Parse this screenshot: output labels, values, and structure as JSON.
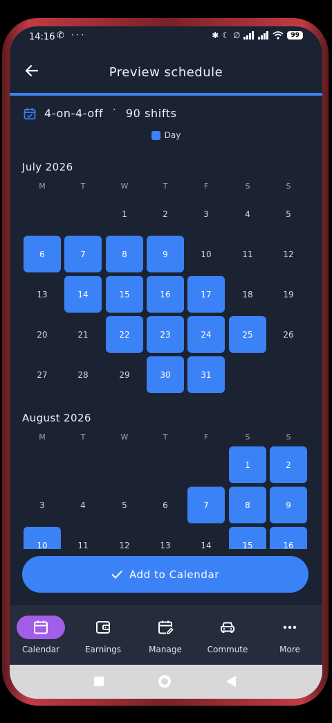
{
  "status": {
    "time": "14:16",
    "left_icons": "✆ ···",
    "battery": "99"
  },
  "header": {
    "title": "Preview schedule"
  },
  "summary": {
    "pattern": "4-on-4-off",
    "separator": "˙",
    "shifts": "90 shifts"
  },
  "legend": {
    "day_label": "Day",
    "day_color": "#3b82f6"
  },
  "weekdays": [
    "M",
    "T",
    "W",
    "T",
    "F",
    "S",
    "S"
  ],
  "months": [
    {
      "title": "July 2026",
      "rows": [
        [
          {
            "d": ""
          },
          {
            "d": ""
          },
          {
            "d": "1"
          },
          {
            "d": "2"
          },
          {
            "d": "3"
          },
          {
            "d": "4"
          },
          {
            "d": "5"
          }
        ],
        [
          {
            "d": "6",
            "s": 1
          },
          {
            "d": "7",
            "s": 1
          },
          {
            "d": "8",
            "s": 1
          },
          {
            "d": "9",
            "s": 1
          },
          {
            "d": "10"
          },
          {
            "d": "11"
          },
          {
            "d": "12"
          }
        ],
        [
          {
            "d": "13"
          },
          {
            "d": "14",
            "s": 1
          },
          {
            "d": "15",
            "s": 1
          },
          {
            "d": "16",
            "s": 1
          },
          {
            "d": "17",
            "s": 1
          },
          {
            "d": "18"
          },
          {
            "d": "19"
          }
        ],
        [
          {
            "d": "20"
          },
          {
            "d": "21"
          },
          {
            "d": "22",
            "s": 1
          },
          {
            "d": "23",
            "s": 1
          },
          {
            "d": "24",
            "s": 1
          },
          {
            "d": "25",
            "s": 1
          },
          {
            "d": "26"
          }
        ],
        [
          {
            "d": "27"
          },
          {
            "d": "28"
          },
          {
            "d": "29"
          },
          {
            "d": "30",
            "s": 1
          },
          {
            "d": "31",
            "s": 1
          },
          {
            "d": ""
          },
          {
            "d": ""
          }
        ]
      ]
    },
    {
      "title": "August 2026",
      "rows": [
        [
          {
            "d": ""
          },
          {
            "d": ""
          },
          {
            "d": ""
          },
          {
            "d": ""
          },
          {
            "d": ""
          },
          {
            "d": "1",
            "s": 1
          },
          {
            "d": "2",
            "s": 1
          }
        ],
        [
          {
            "d": "3"
          },
          {
            "d": "4"
          },
          {
            "d": "5"
          },
          {
            "d": "6"
          },
          {
            "d": "7",
            "s": 1
          },
          {
            "d": "8",
            "s": 1
          },
          {
            "d": "9",
            "s": 1
          }
        ],
        [
          {
            "d": "10",
            "s": 1
          },
          {
            "d": "11"
          },
          {
            "d": "12"
          },
          {
            "d": "13"
          },
          {
            "d": "14"
          },
          {
            "d": "15",
            "s": 1
          },
          {
            "d": "16",
            "s": 1
          }
        ]
      ]
    }
  ],
  "actions": {
    "add_label": "Add to Calendar"
  },
  "nav": [
    {
      "label": "Calendar",
      "icon": "calendar-icon",
      "active": true
    },
    {
      "label": "Earnings",
      "icon": "wallet-icon",
      "active": false
    },
    {
      "label": "Manage",
      "icon": "calendar-edit-icon",
      "active": false
    },
    {
      "label": "Commute",
      "icon": "car-icon",
      "active": false
    },
    {
      "label": "More",
      "icon": "more-dots-icon",
      "active": false
    }
  ],
  "colors": {
    "background": "#1b2333",
    "accent": "#3b82f6",
    "nav_active": "#a35ee8",
    "nav_bar": "#252d3c"
  }
}
